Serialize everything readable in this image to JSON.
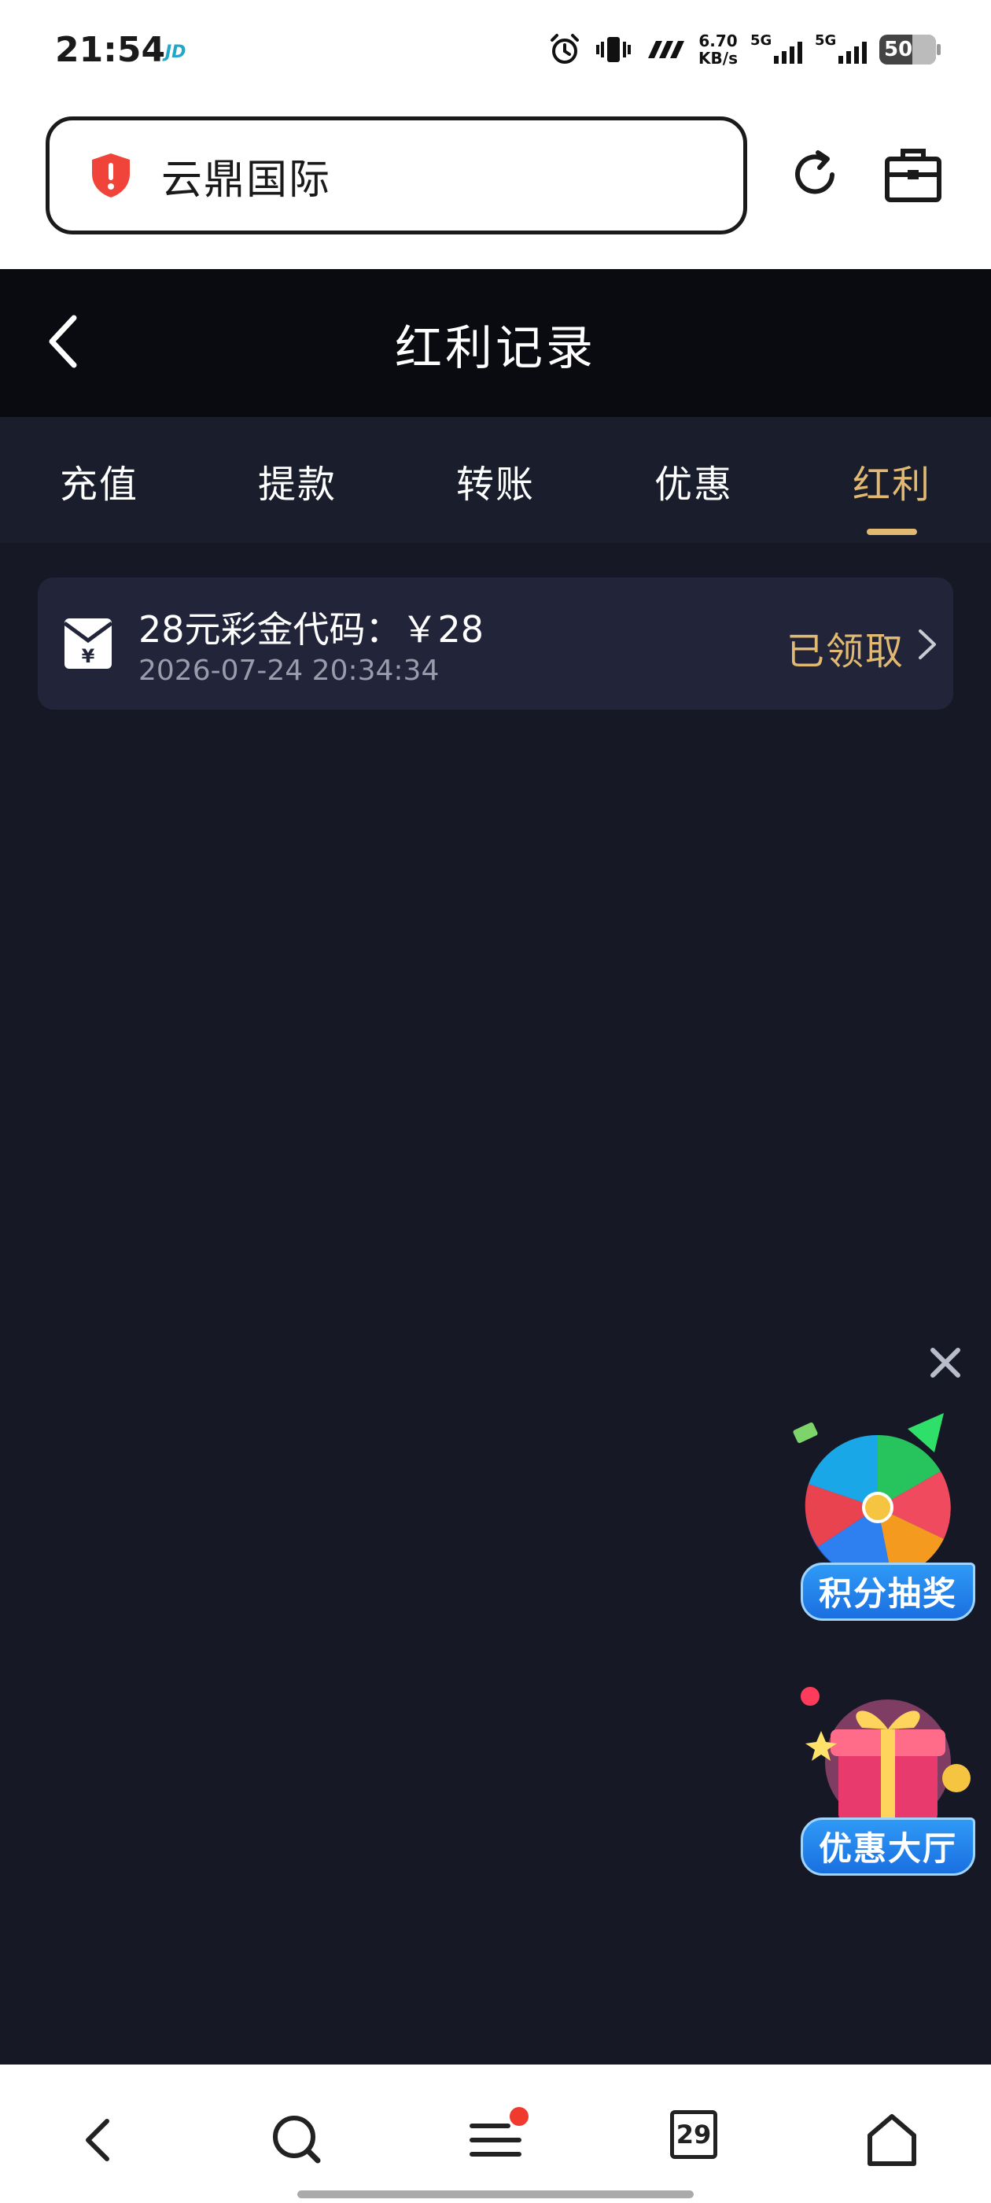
{
  "status_bar": {
    "time": "21:54",
    "app_badge": "JD",
    "speed_value": "6.70",
    "speed_unit": "KB/s",
    "sim1": "5G",
    "sim2": "5G",
    "battery": "50"
  },
  "browser": {
    "url_text": "云鼎国际",
    "security_icon": "shield-warning-icon",
    "reload_icon": "reload-icon",
    "toolbox_icon": "toolbox-icon"
  },
  "header": {
    "title": "红利记录",
    "back_icon": "chevron-left-icon"
  },
  "tabs": [
    {
      "label": "充值",
      "active": false
    },
    {
      "label": "提款",
      "active": false
    },
    {
      "label": "转账",
      "active": false
    },
    {
      "label": "优惠",
      "active": false
    },
    {
      "label": "红利",
      "active": true
    }
  ],
  "records": [
    {
      "title": "28元彩金代码：￥28",
      "time": "2026-07-24 20:34:34",
      "status": "已领取",
      "icon": "red-envelope-icon"
    }
  ],
  "floating": {
    "close_icon": "close-icon",
    "lottery_label": "积分抽奖",
    "promo_label": "优惠大厅"
  },
  "bottom_nav": {
    "tab_count": "29",
    "items": [
      "back-icon",
      "search-icon",
      "menu-icon",
      "tabs-icon",
      "home-icon"
    ]
  },
  "colors": {
    "accent_gold": "#e1b971",
    "background": "#161925",
    "card": "#22253a",
    "header": "#0a0b10"
  }
}
